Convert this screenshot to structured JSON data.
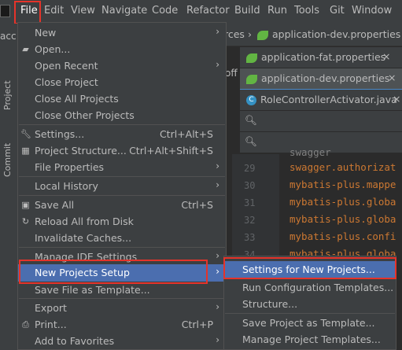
{
  "menubar": {
    "items": [
      "File",
      "Edit",
      "View",
      "Navigate",
      "Code",
      "Refactor",
      "Build",
      "Run",
      "Tools",
      "Git",
      "Window"
    ],
    "active": "File"
  },
  "left_strip": {
    "project_tab": "Project",
    "commit_tab": "Commit",
    "partial_text": "acc"
  },
  "breadcrumb": {
    "path_tail": "rces",
    "file": "application-dev.properties"
  },
  "tabs": [
    {
      "label": "application-fat.properties",
      "icon": "spring-leaf-icon",
      "closable": true
    },
    {
      "label": "application-dev.properties",
      "icon": "spring-leaf-icon",
      "closable": true,
      "active": true
    },
    {
      "label": "RoleControllerActivator.java",
      "icon": "class-icon",
      "closable": true
    }
  ],
  "side_text": "off",
  "editor": {
    "lines": [
      {
        "num": "29",
        "text": "swagger.authorizat"
      },
      {
        "num": "30",
        "text": "mybatis-plus.mappe"
      },
      {
        "num": "31",
        "text": "mybatis-plus.globa"
      },
      {
        "num": "32",
        "text": "mybatis-plus.globa"
      },
      {
        "num": "33",
        "text": "mybatis-plus.confi"
      },
      {
        "num": "34",
        "text": "mybatis-plus.globa"
      }
    ],
    "partial_top": "swagger"
  },
  "file_menu": {
    "items": [
      {
        "label": "New",
        "submenu": true
      },
      {
        "label": "Open...",
        "icon": "folder-icon"
      },
      {
        "label": "Open Recent",
        "submenu": true
      },
      {
        "label": "Close Project"
      },
      {
        "label": "Close All Projects"
      },
      {
        "label": "Close Other Projects"
      },
      {
        "label": "Settings...",
        "shortcut": "Ctrl+Alt+S",
        "icon": "wrench-icon"
      },
      {
        "label": "Project Structure...",
        "shortcut": "Ctrl+Alt+Shift+S",
        "icon": "project-structure-icon"
      },
      {
        "label": "File Properties",
        "submenu": true
      },
      {
        "label": "Local History",
        "submenu": true
      },
      {
        "label": "Save All",
        "shortcut": "Ctrl+S",
        "icon": "save-icon"
      },
      {
        "label": "Reload All from Disk",
        "icon": "reload-icon"
      },
      {
        "label": "Invalidate Caches..."
      },
      {
        "label": "Manage IDE Settings",
        "submenu": true
      },
      {
        "label": "New Projects Setup",
        "submenu": true,
        "selected": true
      },
      {
        "label": "Save File as Template..."
      },
      {
        "label": "Export",
        "submenu": true
      },
      {
        "label": "Print...",
        "shortcut": "Ctrl+P",
        "icon": "print-icon"
      },
      {
        "label": "Add to Favorites",
        "submenu": true
      }
    ]
  },
  "submenu": {
    "items": [
      {
        "label": "Settings for New Projects...",
        "selected": true
      },
      {
        "label": "Run Configuration Templates..."
      },
      {
        "label": "Structure..."
      },
      {
        "label": "Save Project as Template..."
      },
      {
        "label": "Manage Project Templates..."
      }
    ]
  },
  "colors": {
    "selection": "#4b6eaf",
    "highlight_box": "#e5332a",
    "menu_bg": "#3c3f41",
    "code_key": "#cc7832"
  }
}
